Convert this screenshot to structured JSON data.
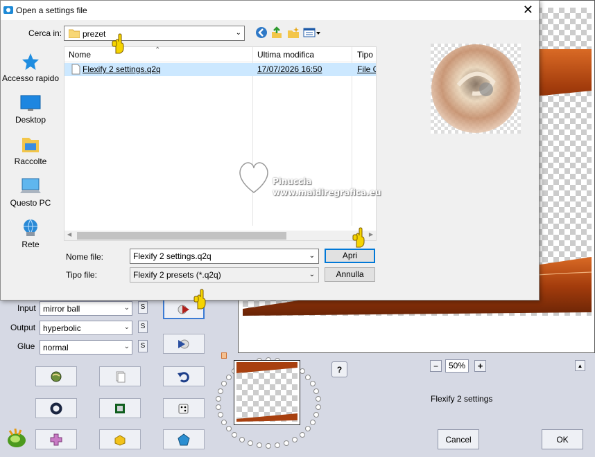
{
  "flexify": {
    "input_label": "Input",
    "input_value": "mirror ball",
    "output_label": "Output",
    "output_value": "hyperbolic",
    "glue_label": "Glue",
    "glue_value": "normal",
    "s_label": "S",
    "zoom_value": "50%",
    "zoom_minus": "−",
    "zoom_plus": "+",
    "help_label": "?",
    "settings_name": "Flexify 2 settings",
    "cancel_label": "Cancel",
    "ok_label": "OK",
    "up_marker": "▲"
  },
  "dialog": {
    "title": "Open a settings file",
    "close": "✕",
    "look_in_label": "Cerca in:",
    "look_in_value": "prezet",
    "places": [
      {
        "label": "Accesso rapido",
        "icon": "star-icon"
      },
      {
        "label": "Desktop",
        "icon": "desktop-icon"
      },
      {
        "label": "Raccolte",
        "icon": "libraries-icon"
      },
      {
        "label": "Questo PC",
        "icon": "computer-icon"
      },
      {
        "label": "Rete",
        "icon": "network-icon"
      }
    ],
    "columns": [
      "Nome",
      "Ultima modifica",
      "Tipo"
    ],
    "files": [
      {
        "name": "Flexify 2 settings.q2q",
        "modified": "17/07/2026 16:50",
        "type": "File C"
      }
    ],
    "filename_label": "Nome file:",
    "filename_value": "Flexify 2 settings.q2q",
    "filetype_label": "Tipo file:",
    "filetype_value": "Flexify 2 presets (*.q2q)",
    "open_label": "Apri",
    "cancel_label": "Annulla"
  },
  "watermark": {
    "line1": "Pinuccia",
    "line2": "www.maidiregrafica.eu"
  },
  "colors": {
    "accent": "#0078d7",
    "selection": "#cce8ff",
    "flexify_bg": "#d6d9e4",
    "copper": "#b3450f"
  }
}
